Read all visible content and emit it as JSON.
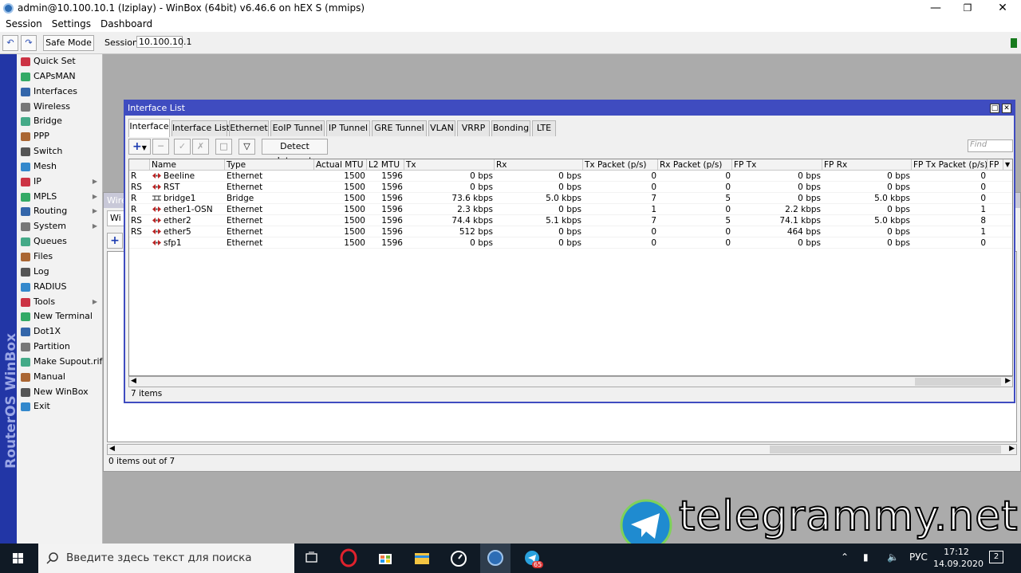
{
  "app": {
    "title": "admin@10.100.10.1 (Iziplay) - WinBox (64bit) v6.46.6 on hEX S (mmips)"
  },
  "menu": [
    "Session",
    "Settings",
    "Dashboard"
  ],
  "toolbar": {
    "safe_mode": "Safe Mode",
    "session_label": "Session:",
    "session_value": "10.100.10.1"
  },
  "sidebar": {
    "brand": "RouterOS WinBox",
    "items": [
      {
        "label": "Quick Set",
        "icon": "quickset-icon",
        "arrow": false
      },
      {
        "label": "CAPsMAN",
        "icon": "capsman-icon",
        "arrow": false
      },
      {
        "label": "Interfaces",
        "icon": "interfaces-icon",
        "arrow": false
      },
      {
        "label": "Wireless",
        "icon": "wireless-icon",
        "arrow": false
      },
      {
        "label": "Bridge",
        "icon": "bridge-icon",
        "arrow": false
      },
      {
        "label": "PPP",
        "icon": "ppp-icon",
        "arrow": false
      },
      {
        "label": "Switch",
        "icon": "switch-icon",
        "arrow": false
      },
      {
        "label": "Mesh",
        "icon": "mesh-icon",
        "arrow": false
      },
      {
        "label": "IP",
        "icon": "ip-icon",
        "arrow": true
      },
      {
        "label": "MPLS",
        "icon": "mpls-icon",
        "arrow": true
      },
      {
        "label": "Routing",
        "icon": "routing-icon",
        "arrow": true
      },
      {
        "label": "System",
        "icon": "system-icon",
        "arrow": true
      },
      {
        "label": "Queues",
        "icon": "queues-icon",
        "arrow": false
      },
      {
        "label": "Files",
        "icon": "files-icon",
        "arrow": false
      },
      {
        "label": "Log",
        "icon": "log-icon",
        "arrow": false
      },
      {
        "label": "RADIUS",
        "icon": "radius-icon",
        "arrow": false
      },
      {
        "label": "Tools",
        "icon": "tools-icon",
        "arrow": true
      },
      {
        "label": "New Terminal",
        "icon": "terminal-icon",
        "arrow": false
      },
      {
        "label": "Dot1X",
        "icon": "dot1x-icon",
        "arrow": false
      },
      {
        "label": "Partition",
        "icon": "partition-icon",
        "arrow": false
      },
      {
        "label": "Make Supout.rif",
        "icon": "supout-icon",
        "arrow": false
      },
      {
        "label": "Manual",
        "icon": "manual-icon",
        "arrow": false
      },
      {
        "label": "New WinBox",
        "icon": "winbox-icon",
        "arrow": false
      },
      {
        "label": "Exit",
        "icon": "exit-icon",
        "arrow": false
      }
    ]
  },
  "bg_window": {
    "title": "Wire",
    "tab": "Wi",
    "status": "0 items out of 7"
  },
  "window": {
    "title": "Interface List",
    "tabs": [
      "Interface",
      "Interface List",
      "Ethernet",
      "EoIP Tunnel",
      "IP Tunnel",
      "GRE Tunnel",
      "VLAN",
      "VRRP",
      "Bonding",
      "LTE"
    ],
    "active_tab": "Interface",
    "detect_button": "Detect Internet",
    "find_placeholder": "Find",
    "columns": [
      "Name",
      "Type",
      "Actual MTU",
      "L2 MTU",
      "Tx",
      "Rx",
      "Tx Packet (p/s)",
      "Rx Packet (p/s)",
      "FP Tx",
      "FP Rx",
      "FP Tx Packet (p/s)",
      "FP"
    ],
    "rows": [
      {
        "flags": "R",
        "name": "Beeline",
        "type": "Ethernet",
        "mtu": "1500",
        "l2mtu": "1596",
        "tx": "0 bps",
        "rx": "0 bps",
        "txp": "0",
        "rxp": "0",
        "fptx": "0 bps",
        "fprx": "0 bps",
        "fptxp": "0",
        "kind": "eth"
      },
      {
        "flags": "RS",
        "name": "RST",
        "type": "Ethernet",
        "mtu": "1500",
        "l2mtu": "1596",
        "tx": "0 bps",
        "rx": "0 bps",
        "txp": "0",
        "rxp": "0",
        "fptx": "0 bps",
        "fprx": "0 bps",
        "fptxp": "0",
        "kind": "eth"
      },
      {
        "flags": "R",
        "name": "bridge1",
        "type": "Bridge",
        "mtu": "1500",
        "l2mtu": "1596",
        "tx": "73.6 kbps",
        "rx": "5.0 kbps",
        "txp": "7",
        "rxp": "5",
        "fptx": "0 bps",
        "fprx": "5.0 kbps",
        "fptxp": "0",
        "kind": "bridge"
      },
      {
        "flags": "R",
        "name": "ether1-OSN",
        "type": "Ethernet",
        "mtu": "1500",
        "l2mtu": "1596",
        "tx": "2.3 kbps",
        "rx": "0 bps",
        "txp": "1",
        "rxp": "0",
        "fptx": "2.2 kbps",
        "fprx": "0 bps",
        "fptxp": "1",
        "kind": "eth"
      },
      {
        "flags": "RS",
        "name": "ether2",
        "type": "Ethernet",
        "mtu": "1500",
        "l2mtu": "1596",
        "tx": "74.4 kbps",
        "rx": "5.1 kbps",
        "txp": "7",
        "rxp": "5",
        "fptx": "74.1 kbps",
        "fprx": "5.0 kbps",
        "fptxp": "8",
        "kind": "eth"
      },
      {
        "flags": "RS",
        "name": "ether5",
        "type": "Ethernet",
        "mtu": "1500",
        "l2mtu": "1596",
        "tx": "512 bps",
        "rx": "0 bps",
        "txp": "0",
        "rxp": "0",
        "fptx": "464 bps",
        "fprx": "0 bps",
        "fptxp": "1",
        "kind": "eth"
      },
      {
        "flags": "",
        "name": "sfp1",
        "type": "Ethernet",
        "mtu": "1500",
        "l2mtu": "1596",
        "tx": "0 bps",
        "rx": "0 bps",
        "txp": "0",
        "rxp": "0",
        "fptx": "0 bps",
        "fprx": "0 bps",
        "fptxp": "0",
        "kind": "eth"
      }
    ],
    "status": "7 items"
  },
  "watermark": "telegrammy.net",
  "taskbar": {
    "search_placeholder": "Введите здесь текст для поиска",
    "lang": "РУС",
    "time": "17:12",
    "date": "14.09.2020",
    "notif_badge": "2",
    "telegram_badge": "65"
  },
  "colors": {
    "accent": "#3f4cc0",
    "brand_bar": "#2236a6",
    "taskbar": "#101a25"
  }
}
